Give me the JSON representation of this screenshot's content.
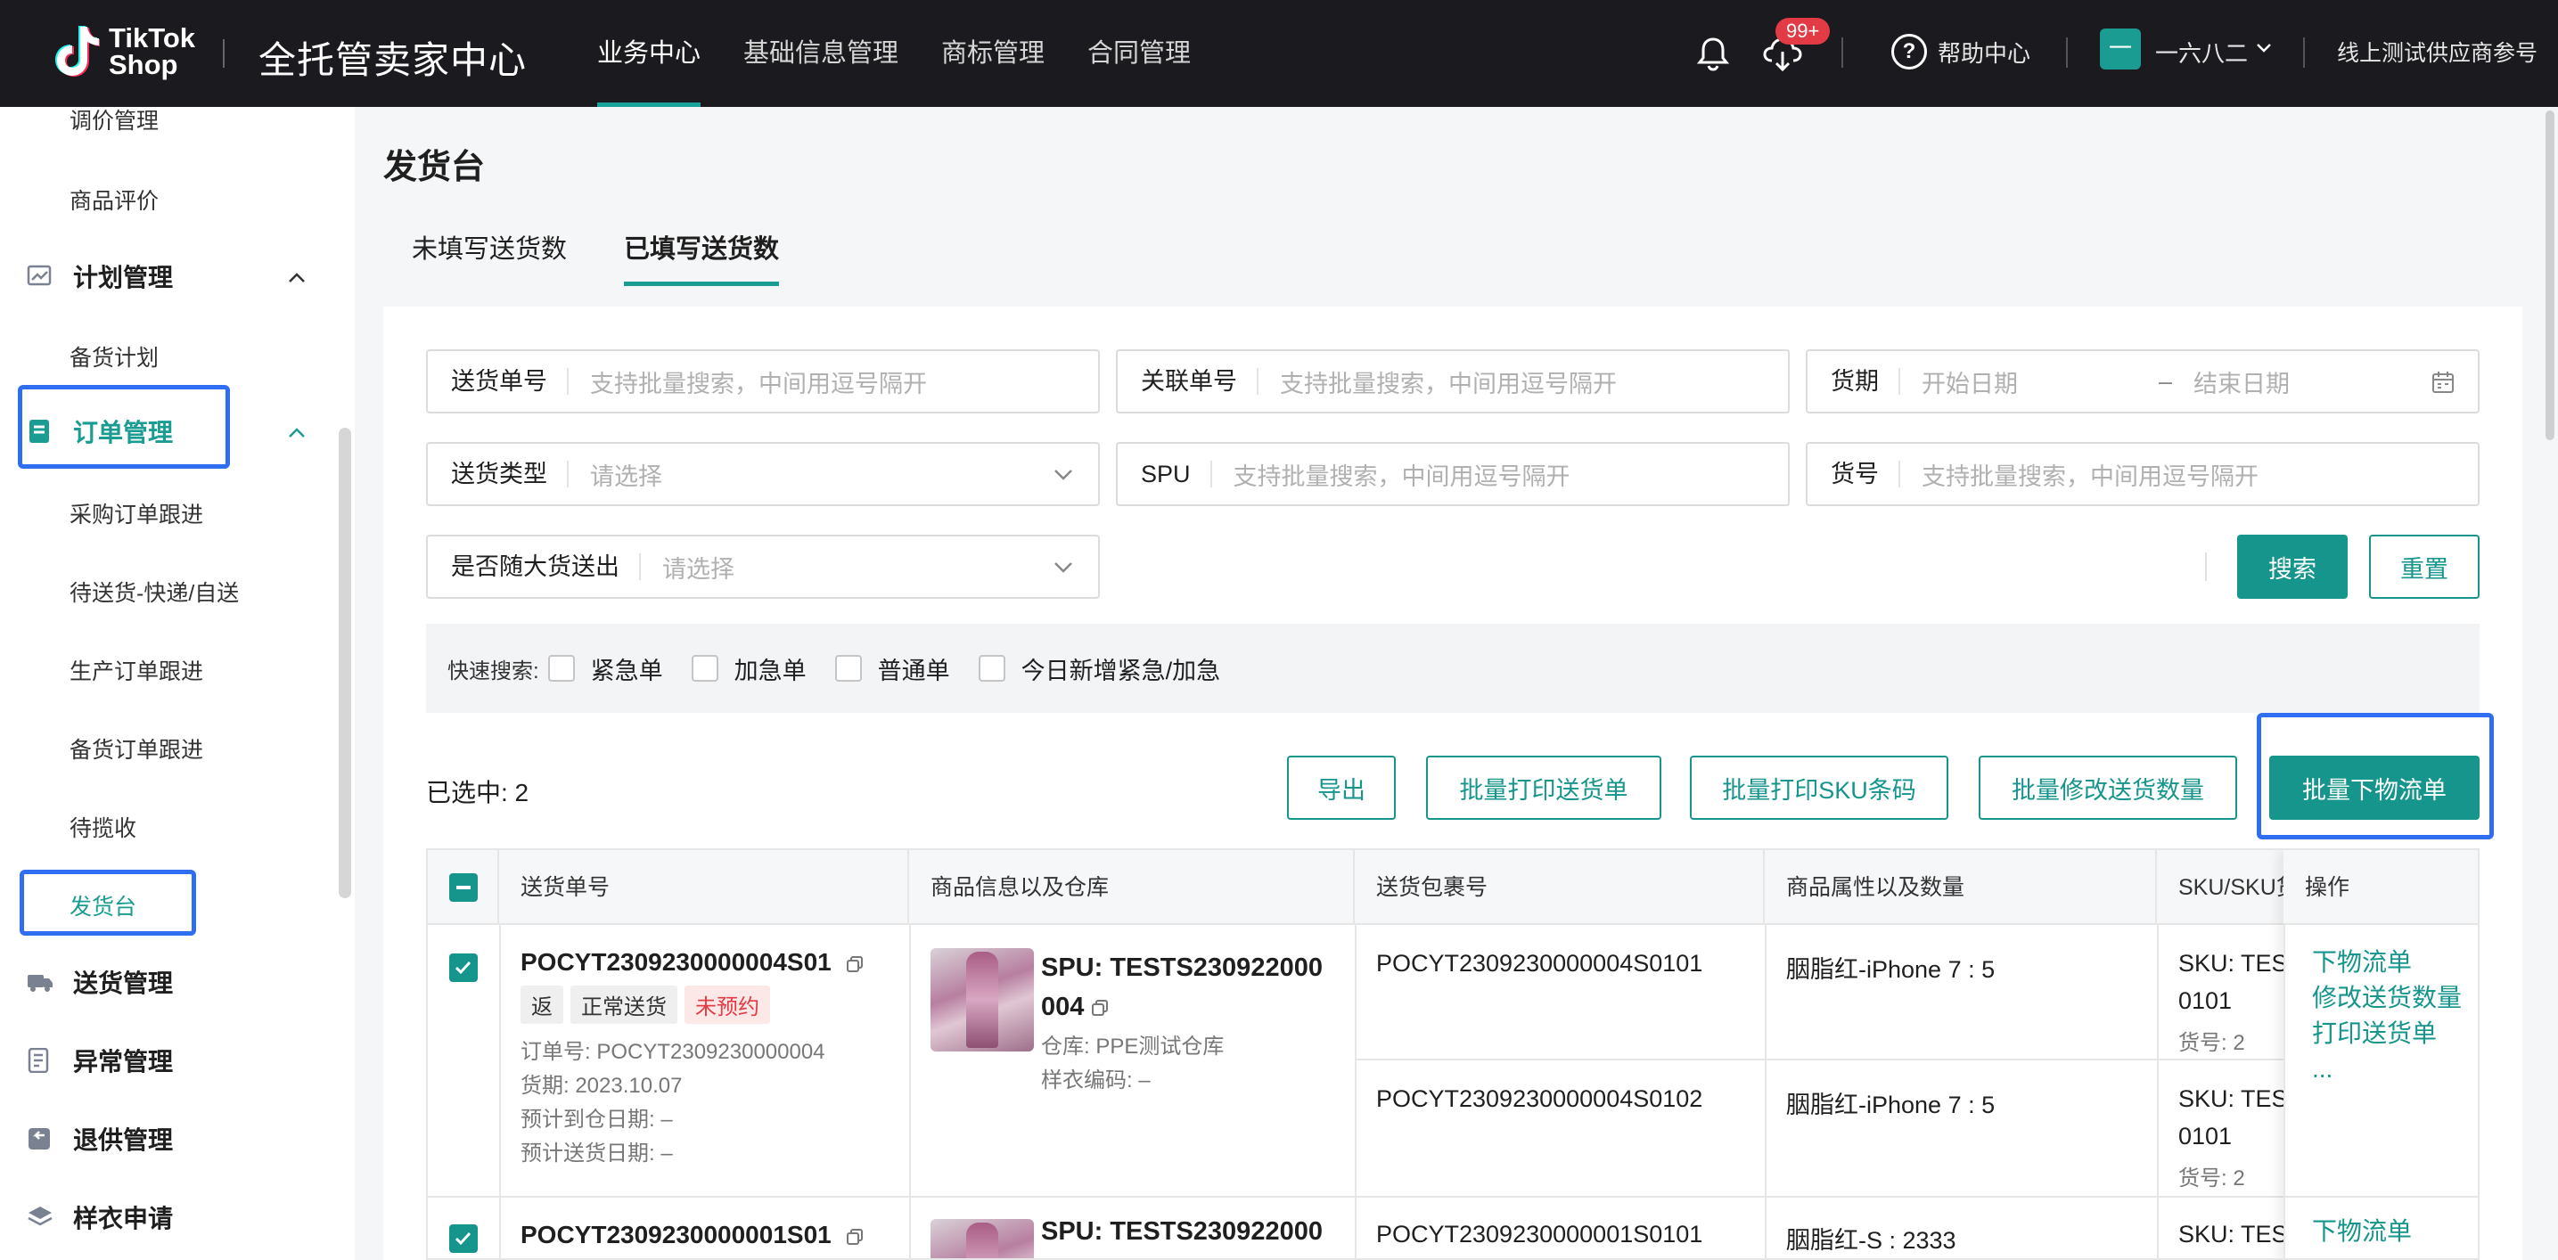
{
  "header": {
    "logo_line1": "TikTok",
    "logo_line2": "Shop",
    "title": "全托管卖家中心",
    "nav": [
      "业务中心",
      "基础信息管理",
      "商标管理",
      "合同管理"
    ],
    "notification_badge": "99+",
    "help": "帮助中心",
    "avatar_char": "一",
    "user": "一六八二",
    "supplier": "线上测试供应商参号"
  },
  "sidebar": {
    "top_items": [
      "调价管理",
      "商品评价"
    ],
    "plan_group": "计划管理",
    "plan_items": [
      "备货计划"
    ],
    "order_group": "订单管理",
    "order_items": [
      "采购订单跟进",
      "待送货-快递/自送",
      "生产订单跟进",
      "备货订单跟进",
      "待揽收",
      "发货台"
    ],
    "groups_below": [
      "送货管理",
      "异常管理",
      "退供管理",
      "样衣申请"
    ]
  },
  "page": {
    "title": "发货台",
    "tabs": [
      "未填写送货数",
      "已填写送货数"
    ],
    "active_tab": 1
  },
  "filters": {
    "delivery_no": {
      "label": "送货单号",
      "placeholder": "支持批量搜索，中间用逗号隔开"
    },
    "related_no": {
      "label": "关联单号",
      "placeholder": "支持批量搜索，中间用逗号隔开"
    },
    "period": {
      "label": "货期",
      "start": "开始日期",
      "sep": "–",
      "end": "结束日期"
    },
    "delivery_type": {
      "label": "送货类型",
      "placeholder": "请选择"
    },
    "spu": {
      "label": "SPU",
      "placeholder": "支持批量搜索，中间用逗号隔开"
    },
    "item_no": {
      "label": "货号",
      "placeholder": "支持批量搜索，中间用逗号隔开"
    },
    "with_bulk": {
      "label": "是否随大货送出",
      "placeholder": "请选择"
    },
    "search_btn": "搜索",
    "reset_btn": "重置"
  },
  "quick_search": {
    "label": "快速搜索:",
    "options": [
      "紧急单",
      "加急单",
      "普通单",
      "今日新增紧急/加急"
    ]
  },
  "toolbar": {
    "selected": "已选中: 2",
    "export": "导出",
    "batch_print_slip": "批量打印送货单",
    "batch_print_sku": "批量打印SKU条码",
    "batch_edit_qty": "批量修改送货数量",
    "batch_logistics": "批量下物流单"
  },
  "table": {
    "headers": [
      "送货单号",
      "商品信息以及仓库",
      "送货包裹号",
      "商品属性以及数量",
      "SKU/SKU货号",
      "操作"
    ],
    "rows": [
      {
        "delivery_no": "POCYT2309230000004S01",
        "tags": [
          "返",
          "正常送货",
          "未预约"
        ],
        "order_no": "订单号: POCYT2309230000004",
        "period": "货期: 2023.10.07",
        "eta_warehouse": "预计到仓日期: –",
        "eta_delivery": "预计送货日期: –",
        "spu_line1": "SPU: TESTS230922000",
        "spu_line2": "004",
        "warehouse": "仓库: PPE测试仓库",
        "sample_code": "样衣编码: –",
        "packages": [
          {
            "no": "POCYT2309230000004S0101",
            "attr": "胭脂红-iPhone 7 : 5",
            "sku1": "SKU: TES",
            "sku2": "0101",
            "item": "货号: 2"
          },
          {
            "no": "POCYT2309230000004S0102",
            "attr": "胭脂红-iPhone 7 : 5",
            "sku1": "SKU: TES",
            "sku2": "0101",
            "item": "货号: 2"
          }
        ],
        "actions": [
          "下物流单",
          "修改送货数量",
          "打印送货单",
          "..."
        ]
      },
      {
        "delivery_no": "POCYT2309230000001S01",
        "spu_line1": "SPU: TESTS230922000",
        "packages": [
          {
            "no": "POCYT2309230000001S0101",
            "attr": "胭脂红-S : 2333",
            "sku1": "SKU: TES"
          }
        ],
        "actions": [
          "下物流单"
        ]
      }
    ]
  },
  "colors": {
    "accent": "#15958c",
    "highlight": "#2f6ef0",
    "topbar": "#1b1b1f",
    "danger": "#e23b45"
  }
}
